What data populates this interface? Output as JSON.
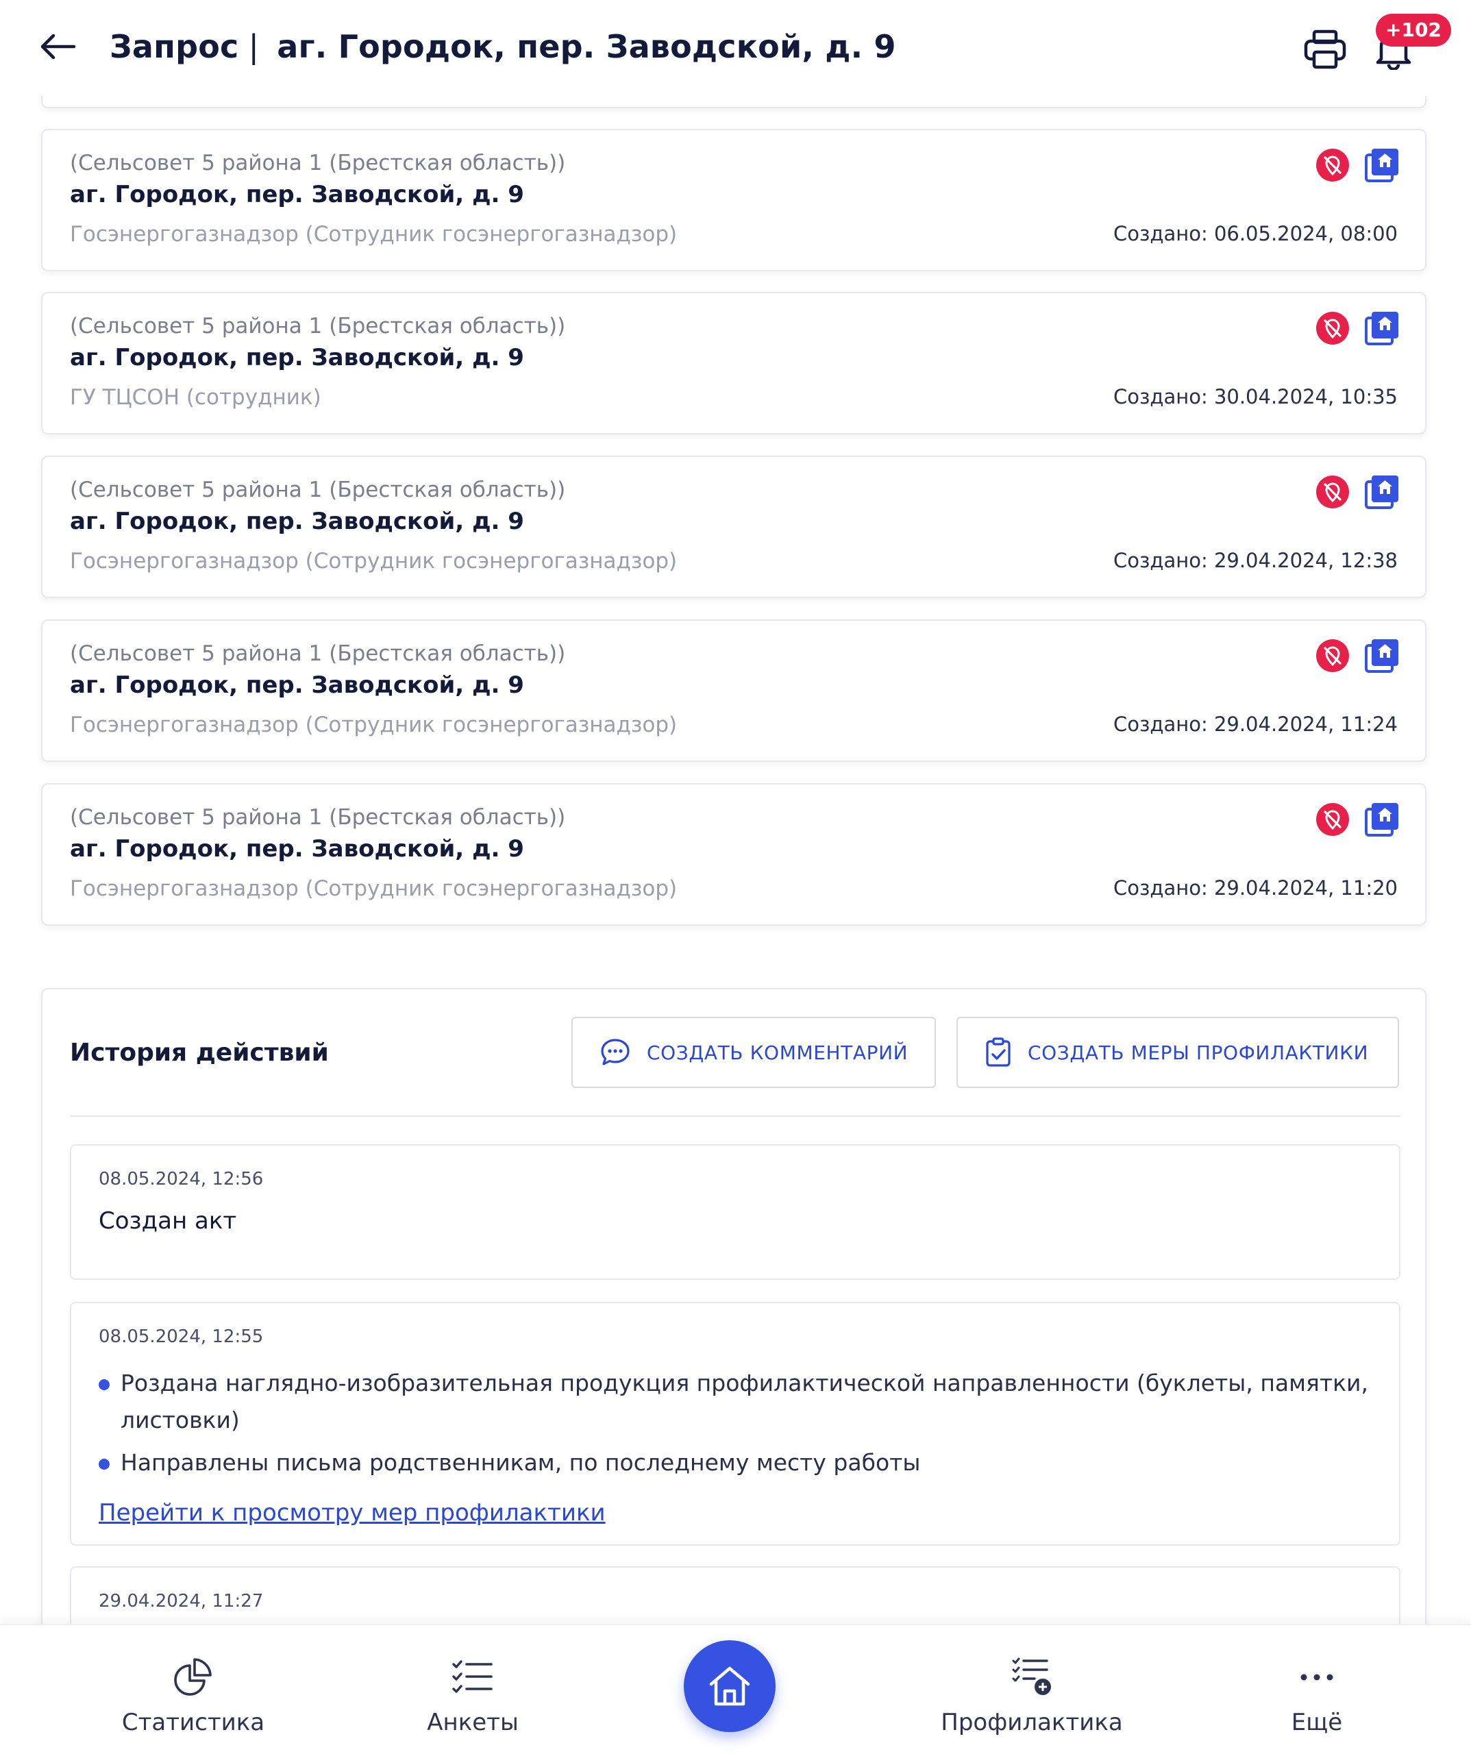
{
  "header": {
    "title_prefix": "Запрос",
    "title_separator": "|",
    "title_address": "аг. Городок, пер. Заводской, д. 9",
    "notification_badge": "+102"
  },
  "requests": [
    {
      "org": "(Сельсовет 5 района 1 (Брестская область))",
      "address": "аг. Городок, пер. Заводской, д. 9",
      "role": "Госэнергогазнадзор (Сотрудник госэнергогазнадзор)",
      "created": "Создано: 06.05.2024, 08:00"
    },
    {
      "org": "(Сельсовет 5 района 1 (Брестская область))",
      "address": "аг. Городок, пер. Заводской, д. 9",
      "role": "ГУ ТЦСОН (сотрудник)",
      "created": "Создано: 30.04.2024, 10:35"
    },
    {
      "org": "(Сельсовет 5 района 1 (Брестская область))",
      "address": "аг. Городок, пер. Заводской, д. 9",
      "role": "Госэнергогазнадзор (Сотрудник госэнергогазнадзор)",
      "created": "Создано: 29.04.2024, 12:38"
    },
    {
      "org": "(Сельсовет 5 района 1 (Брестская область))",
      "address": "аг. Городок, пер. Заводской, д. 9",
      "role": "Госэнергогазнадзор (Сотрудник госэнергогазнадзор)",
      "created": "Создано: 29.04.2024, 11:24"
    },
    {
      "org": "(Сельсовет 5 района 1 (Брестская область))",
      "address": "аг. Городок, пер. Заводской, д. 9",
      "role": "Госэнергогазнадзор (Сотрудник госэнергогазнадзор)",
      "created": "Создано: 29.04.2024, 11:20"
    }
  ],
  "history": {
    "title": "История действий",
    "create_comment_label": "СОЗДАТЬ КОММЕНТАРИЙ",
    "create_prevention_label": "СОЗДАТЬ МЕРЫ ПРОФИЛАКТИКИ",
    "entries": [
      {
        "timestamp": "08.05.2024, 12:56",
        "text": "Создан акт"
      },
      {
        "timestamp": "08.05.2024, 12:55",
        "bullets": [
          "Роздана наглядно-изобразительная продукция профилактической направленности (буклеты, памятки, листовки)",
          "Направлены письма родственникам, по последнему месту работы"
        ],
        "link": "Перейти к просмотру мер профилактики"
      },
      {
        "timestamp": "29.04.2024, 11:27"
      }
    ]
  },
  "bottom_nav": {
    "statistics": "Статистика",
    "forms": "Анкеты",
    "prevention": "Профилактика",
    "more": "Ещё"
  },
  "colors": {
    "accent": "#3553e0",
    "link": "#2a47d6",
    "badge": "#e8214a",
    "text_dark": "#141a3a"
  }
}
